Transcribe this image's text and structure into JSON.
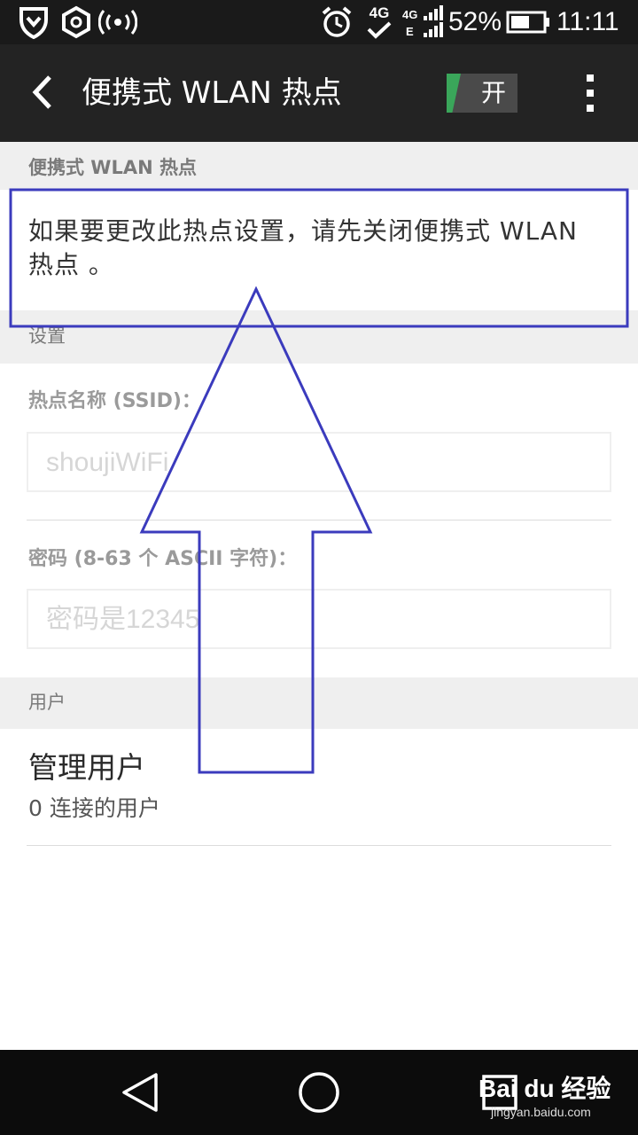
{
  "status_bar": {
    "battery_percent": "52%",
    "time": "11:11",
    "network_4g": "4G",
    "network_e": "E",
    "icons": [
      "shield-icon",
      "settings-hexagon-icon",
      "wifi-hotspot-icon",
      "alarm-icon",
      "4g-check-icon",
      "signal-icon",
      "battery-icon"
    ]
  },
  "action_bar": {
    "title": "便携式 WLAN 热点",
    "toggle_label": "开",
    "toggle_color": "#3aa65a"
  },
  "sections": {
    "hotspot_header": "便携式 WLAN 热点",
    "info_message": "如果要更改此热点设置，请先关闭便携式 WLAN 热点 。",
    "settings_header": "设置",
    "users_header": "用户"
  },
  "fields": {
    "ssid_label": "热点名称 (SSID)：",
    "ssid_value": "shoujiWiFi",
    "password_label": "密码 (8-63 个 ASCII 字符)：",
    "password_value": "密码是12345"
  },
  "users": {
    "manage_title": "管理用户",
    "connected_count": "0 连接的用户"
  },
  "nav_bar": {
    "icons": [
      "back-triangle-icon",
      "home-circle-icon",
      "recents-square-icon"
    ]
  },
  "watermark": {
    "logo": "Bai du 经验",
    "url": "jingyan.baidu.com"
  },
  "annotation_color": "#3b3bbd"
}
